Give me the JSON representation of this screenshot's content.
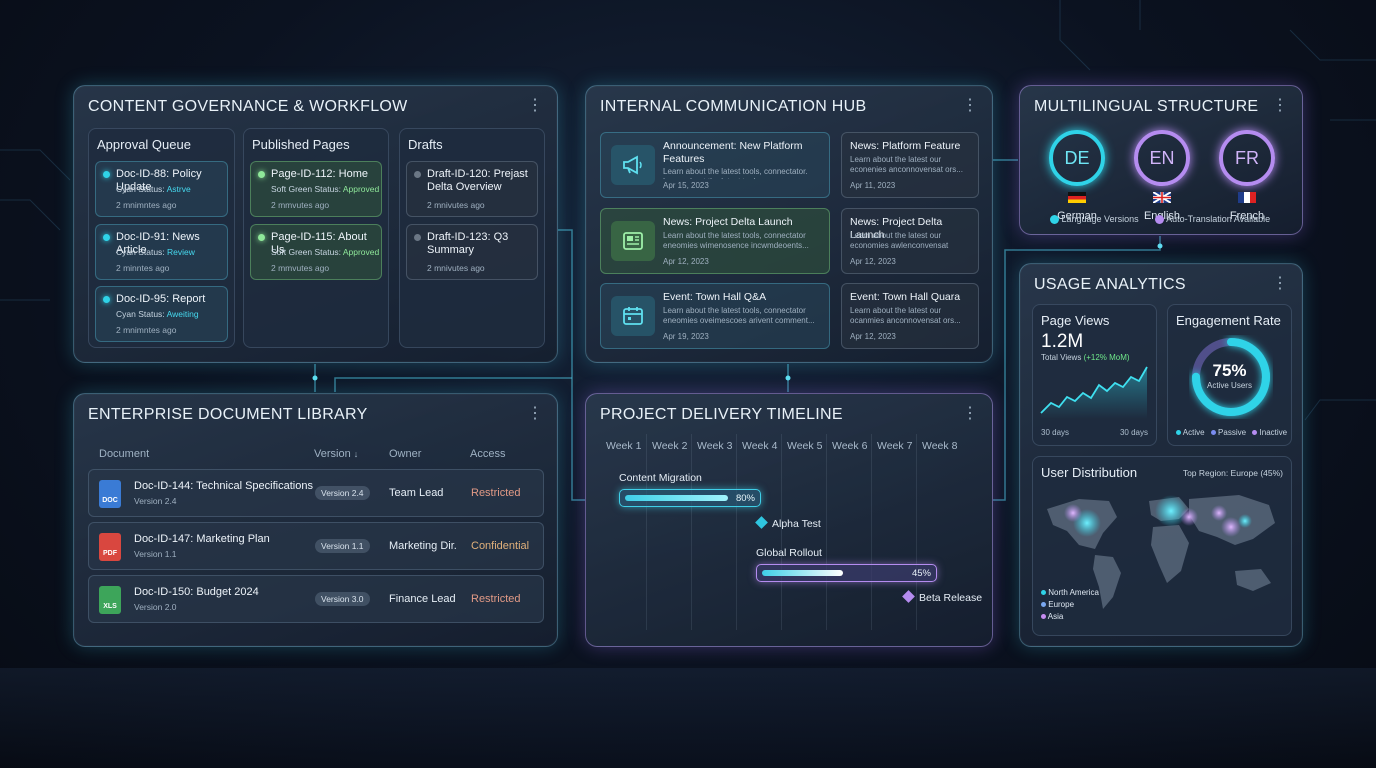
{
  "content_governance": {
    "title": "CONTENT GOVERNANCE & WORKFLOW",
    "columns": [
      {
        "title": "Approval Queue",
        "items": [
          {
            "title": "Doc-ID-88: Policy Update",
            "status_prefix": "Cyan Status:",
            "status": "Astrve",
            "time": "2 mnimntes ago"
          },
          {
            "title": "Doc-ID-91: News Article",
            "status_prefix": "Cyan Status:",
            "status": "Review",
            "time": "2 minntes ago"
          },
          {
            "title": "Doc-ID-95: Report",
            "status_prefix": "Cyan Status:",
            "status": "Aweiting",
            "time": "2 mnimntes ago"
          }
        ]
      },
      {
        "title": "Published Pages",
        "items": [
          {
            "title": "Page-ID-112: Home",
            "status_prefix": "Soft Green Status:",
            "status": "Approved",
            "time": "2 mmvutes ago"
          },
          {
            "title": "Page-ID-115: About Us",
            "status_prefix": "Soft Green Status:",
            "status": "Approved",
            "time": "2 mmvutes ago"
          }
        ]
      },
      {
        "title": "Drafts",
        "items": [
          {
            "title": "Draft-ID-120: Prejast Delta Overview",
            "time": "2 mnivutes ago"
          },
          {
            "title": "Draft-ID-123: Q3 Summary",
            "time": "2 mnivutes ago"
          }
        ]
      }
    ]
  },
  "communication_hub": {
    "title": "INTERNAL COMMUNICATION HUB",
    "featured": [
      {
        "icon": "megaphone-icon",
        "title": "Announcement: New Platform Features",
        "body": "Learn about the latest tools, connectator. Learn about the latest tools.",
        "date": "Apr 15, 2023"
      },
      {
        "icon": "newspaper-icon",
        "title": "News: Project Delta Launch",
        "body": "Learn about the latest tools, connectator eneomies wimenosence incwmdeoents...",
        "date": "Apr 12, 2023"
      },
      {
        "icon": "calendar-icon",
        "title": "Event: Town Hall Q&A",
        "body": "Learn about the latest tools, connectator eneomies oveimescoes arivent comment...",
        "date": "Apr 19, 2023"
      }
    ],
    "side": [
      {
        "title": "News: Platform Feature",
        "body": "Learn about the latest our econenies anconnovensat ors...",
        "date": "Apr 11, 2023"
      },
      {
        "title": "News: Project Delta Launch",
        "body": "Learn about the latest our economies awlenconvensat ors...",
        "date": "Apr 12, 2023"
      },
      {
        "title": "Event: Town Hall Quara",
        "body": "Learn about the latest our ocanmies anconnovensat ors...",
        "date": "Apr 12, 2023"
      }
    ]
  },
  "multilingual": {
    "title": "MULTILINGUAL STRUCTURE",
    "languages": [
      {
        "code": "DE",
        "name": "German",
        "color": "#2fd3e8"
      },
      {
        "code": "EN",
        "name": "English",
        "color": "#b58cf0"
      },
      {
        "code": "FR",
        "name": "French",
        "color": "#b58cf0"
      }
    ],
    "legend": [
      {
        "label": "Language Versions",
        "color": "#2fd3e8"
      },
      {
        "label": "Auto-Translation Available",
        "color": "#b58cf0"
      }
    ]
  },
  "document_library": {
    "title": "ENTERPRISE DOCUMENT LIBRARY",
    "headers": {
      "document": "Document",
      "version": "Version",
      "owner": "Owner",
      "access": "Access",
      "sort_glyph": "↓"
    },
    "rows": [
      {
        "type": "DOC",
        "type_color": "#3a7bd5",
        "name": "Doc-ID-144: Technical Specifications",
        "version_line": "Version 2.4",
        "version": "Version 2.4",
        "owner": "Team Lead",
        "access": "Restricted"
      },
      {
        "type": "PDF",
        "type_color": "#d9473f",
        "name": "Doc-ID-147: Marketing Plan",
        "version_line": "Version 1.1",
        "version": "Version 1.1",
        "owner": "Marketing Dir.",
        "access": "Confidential"
      },
      {
        "type": "XLS",
        "type_color": "#3da55a",
        "name": "Doc-ID-150: Budget 2024",
        "version_line": "Version 2.0",
        "version": "Version 3.0",
        "owner": "Finance Lead",
        "access": "Restricted"
      }
    ]
  },
  "timeline": {
    "title": "PROJECT DELIVERY TIMELINE",
    "weeks": [
      "Week 1",
      "Week 2",
      "Week 3",
      "Week 4",
      "Week 5",
      "Week 6",
      "Week 7",
      "Week 8"
    ],
    "tasks": [
      {
        "label": "Content Migration",
        "progress": 0.8,
        "progress_label": "80%"
      },
      {
        "label": "Global Rollout",
        "progress": 0.45,
        "progress_label": "45%"
      }
    ],
    "milestones": [
      {
        "label": "Alpha Test",
        "color": "#2fc6e0"
      },
      {
        "label": "Beta Release",
        "color": "#b58cf0"
      }
    ]
  },
  "usage_analytics": {
    "title": "USAGE ANALYTICS",
    "page_views": {
      "title": "Page Views",
      "value": "1.2M",
      "caption": "Total Views",
      "delta": "(+12% MoM)",
      "x_start": "30 days",
      "x_end": "30 days"
    },
    "engagement": {
      "title": "Engagement Rate",
      "value": "75%",
      "caption": "Active Users",
      "active_fraction": 0.75,
      "legend": [
        {
          "label": "Active",
          "color": "#2fd3e8"
        },
        {
          "label": "Passive",
          "color": "#7a8cf0"
        },
        {
          "label": "Inactive",
          "color": "#b58cf0"
        }
      ]
    },
    "distribution": {
      "title": "User Distribution",
      "top_region": "Top Region: Europe (45%)",
      "legend": [
        {
          "label": "North America",
          "color": "#2fd3e8"
        },
        {
          "label": "Europe",
          "color": "#7aa8f0"
        },
        {
          "label": "Asia",
          "color": "#c58cf0"
        }
      ]
    }
  }
}
